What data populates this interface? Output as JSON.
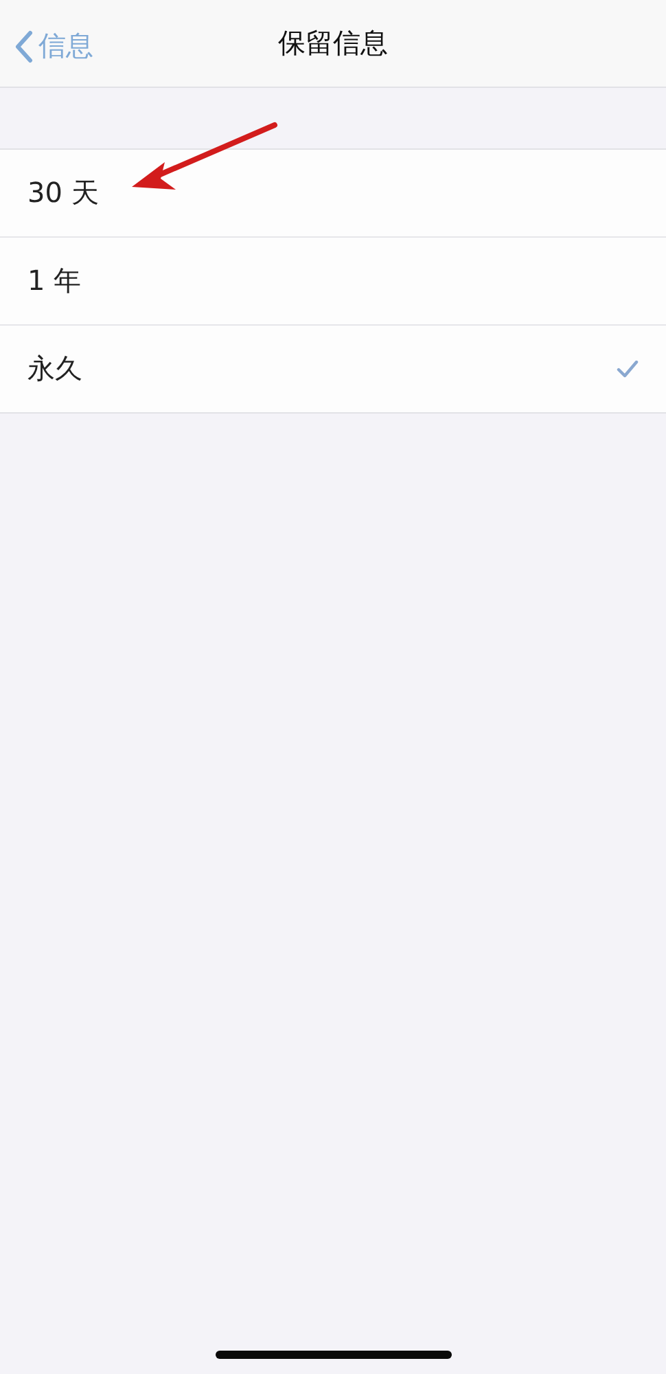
{
  "nav_bar": {
    "back_label": "信息",
    "title": "保留信息"
  },
  "options": [
    {
      "label": "30 天",
      "selected": false
    },
    {
      "label": "1 年",
      "selected": false
    },
    {
      "label": "永久",
      "selected": true
    }
  ]
}
